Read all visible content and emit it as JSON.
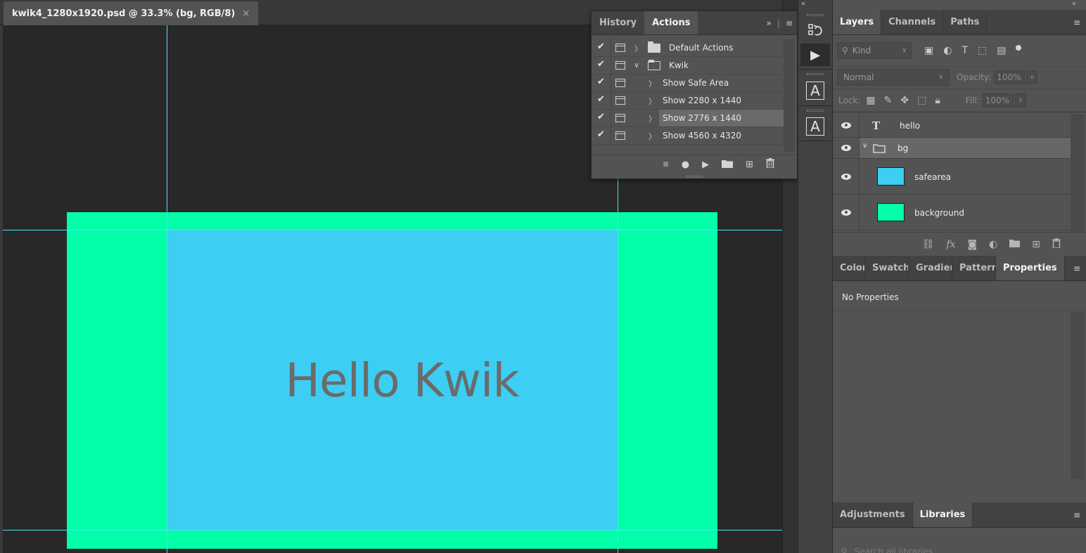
{
  "document": {
    "tab_title": "kwik4_1280x1920.psd @ 33.3% (bg, RGB/8)",
    "close_glyph": "×",
    "canvas_text": "Hello Kwik",
    "colors": {
      "background_layer": "#03ffa7",
      "safearea_layer": "#3dcef4",
      "guide": "#45e6ef",
      "text": "#6b6b6b"
    }
  },
  "actions_panel": {
    "tabs": [
      {
        "label": "History",
        "active": false
      },
      {
        "label": "Actions",
        "active": true
      }
    ],
    "expand_glyph": "»",
    "menu_glyph": "≡",
    "rows": [
      {
        "label": "Default Actions",
        "type": "set",
        "expanded": false
      },
      {
        "label": "Kwik",
        "type": "set",
        "expanded": true
      },
      {
        "label": "Show Safe Area",
        "type": "action"
      },
      {
        "label": "Show 2280 x 1440",
        "type": "action"
      },
      {
        "label": "Show 2776 x 1440",
        "type": "action",
        "selected": true
      },
      {
        "label": "Show 4560 x 4320",
        "type": "action"
      }
    ],
    "checkmark": "✔",
    "chevron_closed": "〉",
    "chevron_open": "∨",
    "footer": {
      "stop": "■",
      "record": "●",
      "play": "▶",
      "new_set": "folder-icon",
      "new_action": "⊞",
      "delete": "trash-icon"
    }
  },
  "icon_column": {
    "collapse_left": "«",
    "collapse_right": "«",
    "history_icon": "history-brush-icon",
    "play_glyph": "▶",
    "char_glyph_1": "A",
    "char_glyph_2": "A"
  },
  "layers_panel": {
    "tabs": [
      {
        "label": "Layers",
        "active": true
      },
      {
        "label": "Channels",
        "active": false
      },
      {
        "label": "Paths",
        "active": false
      }
    ],
    "menu_glyph": "≡",
    "filter": {
      "kind_label": "Kind",
      "search_glyph": "⚲"
    },
    "blend_mode": "Normal",
    "opacity_label": "Opacity:",
    "opacity_value": "100%",
    "lock_label": "Lock:",
    "fill_label": "Fill:",
    "fill_value": "100%",
    "layers": [
      {
        "name": "hello",
        "type": "text",
        "type_glyph": "T"
      },
      {
        "name": "bg",
        "type": "group",
        "selected": true,
        "expanded": true
      },
      {
        "name": "safearea",
        "type": "pixel",
        "color": "#3dcef4"
      },
      {
        "name": "background",
        "type": "pixel",
        "color": "#03ffa7"
      }
    ],
    "footer_fx": "fx"
  },
  "properties_panel": {
    "tabs": [
      {
        "label": "Color",
        "active": false
      },
      {
        "label": "Swatches",
        "active": false
      },
      {
        "label": "Gradients",
        "active": false
      },
      {
        "label": "Patterns",
        "active": false
      },
      {
        "label": "Properties",
        "active": true
      }
    ],
    "menu_glyph": "≡",
    "message": "No Properties"
  },
  "libraries_panel": {
    "tabs": [
      {
        "label": "Adjustments",
        "active": false
      },
      {
        "label": "Libraries",
        "active": true
      }
    ],
    "menu_glyph": "≡",
    "search_placeholder": "Search all libraries"
  }
}
